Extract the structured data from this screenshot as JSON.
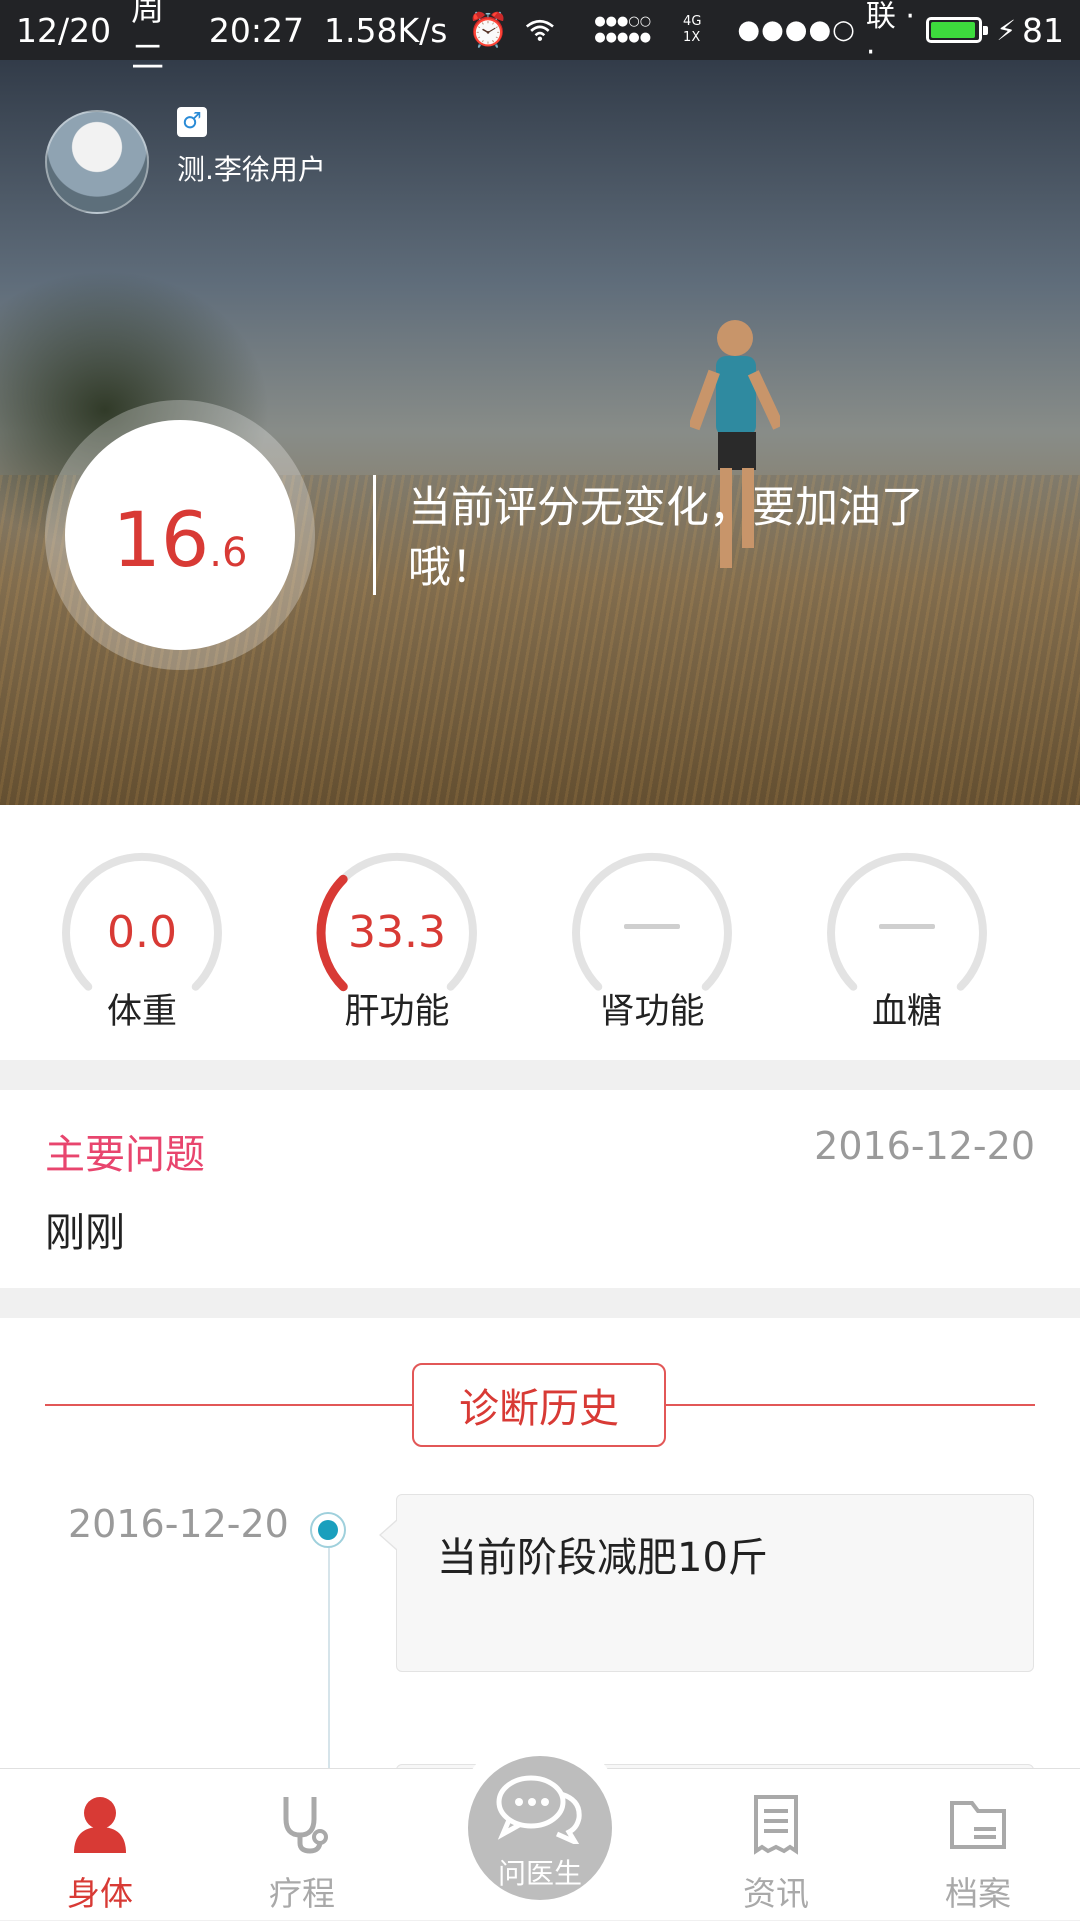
{
  "status_bar": {
    "date": "12/20",
    "weekday": "周二",
    "time": "20:27",
    "speed": "1.58K/s",
    "net_4g": "4G",
    "net_1x": "1X",
    "carrier": "联 · ·",
    "battery": "81",
    "battery_level": 0.81
  },
  "profile": {
    "gender_symbol": "♂",
    "username": "测.李徐用户"
  },
  "score": {
    "integer": "16",
    "decimal": ".6",
    "message": "当前评分无变化，要加油了哦！"
  },
  "gauges": [
    {
      "label": "体重",
      "value": "0.0",
      "progress": 0
    },
    {
      "label": "肝功能",
      "value": "33.3",
      "progress": 0.333
    },
    {
      "label": "肾功能",
      "value": "",
      "progress": 0
    },
    {
      "label": "血糖",
      "value": "",
      "progress": 0
    }
  ],
  "main_problem": {
    "title": "主要问题",
    "date": "2016-12-20",
    "text": "刚刚"
  },
  "history": {
    "button_label": "诊断历史",
    "entries": [
      {
        "date": "2016-12-20",
        "text": "当前阶段减肥10斤"
      }
    ]
  },
  "tabbar": {
    "tabs": [
      {
        "label": "身体",
        "icon": "person-icon",
        "active": true
      },
      {
        "label": "疗程",
        "icon": "stethoscope-icon",
        "active": false
      },
      {
        "label": "资讯",
        "icon": "receipt-icon",
        "active": false
      },
      {
        "label": "档案",
        "icon": "folder-icon",
        "active": false
      }
    ],
    "center_label": "问医生",
    "center_icon": "chat-bubbles-icon"
  },
  "colors": {
    "accent_red": "#d83a35",
    "pink": "#e8456e",
    "timeline_blue": "#1a9fbd"
  }
}
